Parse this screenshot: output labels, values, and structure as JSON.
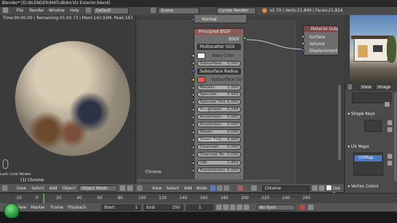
{
  "window": {
    "title": "Blender* [D:\\BLENDER\\MATLIB\\ArcViz Exterior.blend]"
  },
  "info_header": {
    "menus": [
      "File",
      "Render",
      "Window",
      "Help"
    ],
    "layout": "Default",
    "scene": "Scene",
    "engine": "Cycles Render",
    "stats": "v2.79 | Verts:21,846 | Faces:21,824"
  },
  "viewport": {
    "info_line": "Time:00:00.00 | Remaining:01:00.73 | Mem:143.93M, Peak:167.83M | Path Tracing Sample 1/1",
    "object_label": "(1) Chrome",
    "last_op": "Last: Link Nodes",
    "menus": [
      "View",
      "Select",
      "Add",
      "Object"
    ],
    "mode": "Object Mode"
  },
  "node_editor": {
    "frame_label": "Chrome",
    "top_socket": "Normal",
    "menus": [
      "View",
      "Select",
      "Add",
      "Node"
    ],
    "material": "Chrome",
    "use_nodes": "Use N",
    "bsdf": {
      "title": "Principled BSDF",
      "output": "BSDF",
      "distribution": "Multiscatter GGX",
      "base_color_label": "Base Color",
      "subsurface_label": "Subsurface:",
      "subsurface_value": "0.000",
      "subsurface_method": "Subsurface Radius",
      "subsurface_color_label": "Subsurface Col",
      "props": [
        {
          "label": "Metallic:",
          "value": "1.000"
        },
        {
          "label": "Specular:",
          "value": "0.500"
        },
        {
          "label": "Specular Tint:",
          "value": "0.000"
        },
        {
          "label": "Roughness:",
          "value": "0.244"
        },
        {
          "label": "Anisotropic:",
          "value": "0.000"
        },
        {
          "label": "Anisotropic:",
          "value": "0.000"
        },
        {
          "label": "Sheen:",
          "value": "0.000"
        },
        {
          "label": "Sheen Tint:",
          "value": "0.500"
        },
        {
          "label": "Clearcoat:",
          "value": "0.000"
        },
        {
          "label": "Clearcoat Ro:",
          "value": "0.030"
        },
        {
          "label": "IOR:",
          "value": "1.450"
        },
        {
          "label": "Transmission:",
          "value": "0.000"
        }
      ]
    },
    "output_node": {
      "title": "Material Output",
      "inputs": [
        "Surface",
        "Volume",
        "Displacement"
      ]
    }
  },
  "properties": {
    "tabs": [
      "View",
      "Image"
    ],
    "panels": [
      "Shape Keys",
      "UV Maps",
      "Vertex Colors"
    ],
    "uv_map": "UVMap"
  },
  "timeline": {
    "ticks": [
      "-20",
      "0",
      "20",
      "40",
      "60",
      "80",
      "100",
      "120",
      "140",
      "160",
      "180",
      "200",
      "220",
      "240",
      "260"
    ],
    "menus": [
      "View",
      "Marker",
      "Frame",
      "Playback"
    ],
    "start_label": "Start:",
    "start_value": "1",
    "end_label": "End:",
    "end_value": "250",
    "current_frame": "1",
    "sync": "No Sync"
  },
  "colors": {
    "background": "#3d3d3d",
    "header": "#565656",
    "node_body": "#6e6e6e",
    "subsurface_color": "#e45a4a",
    "uv_selected": "#4a78c4"
  }
}
